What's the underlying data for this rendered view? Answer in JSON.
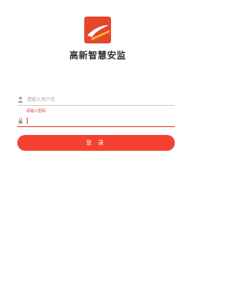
{
  "app": {
    "title": "高新智慧安监"
  },
  "login": {
    "username_placeholder": "请输入用户名",
    "username_value": "",
    "error_message": "请输入密码",
    "password_value": "",
    "submit_label": "登 录"
  },
  "colors": {
    "accent": "#f5412f",
    "error": "#e53935",
    "logo_bg": "#e4452b"
  },
  "icons": {
    "logo": "logo-icon",
    "user": "user-icon",
    "lock": "lock-icon"
  }
}
